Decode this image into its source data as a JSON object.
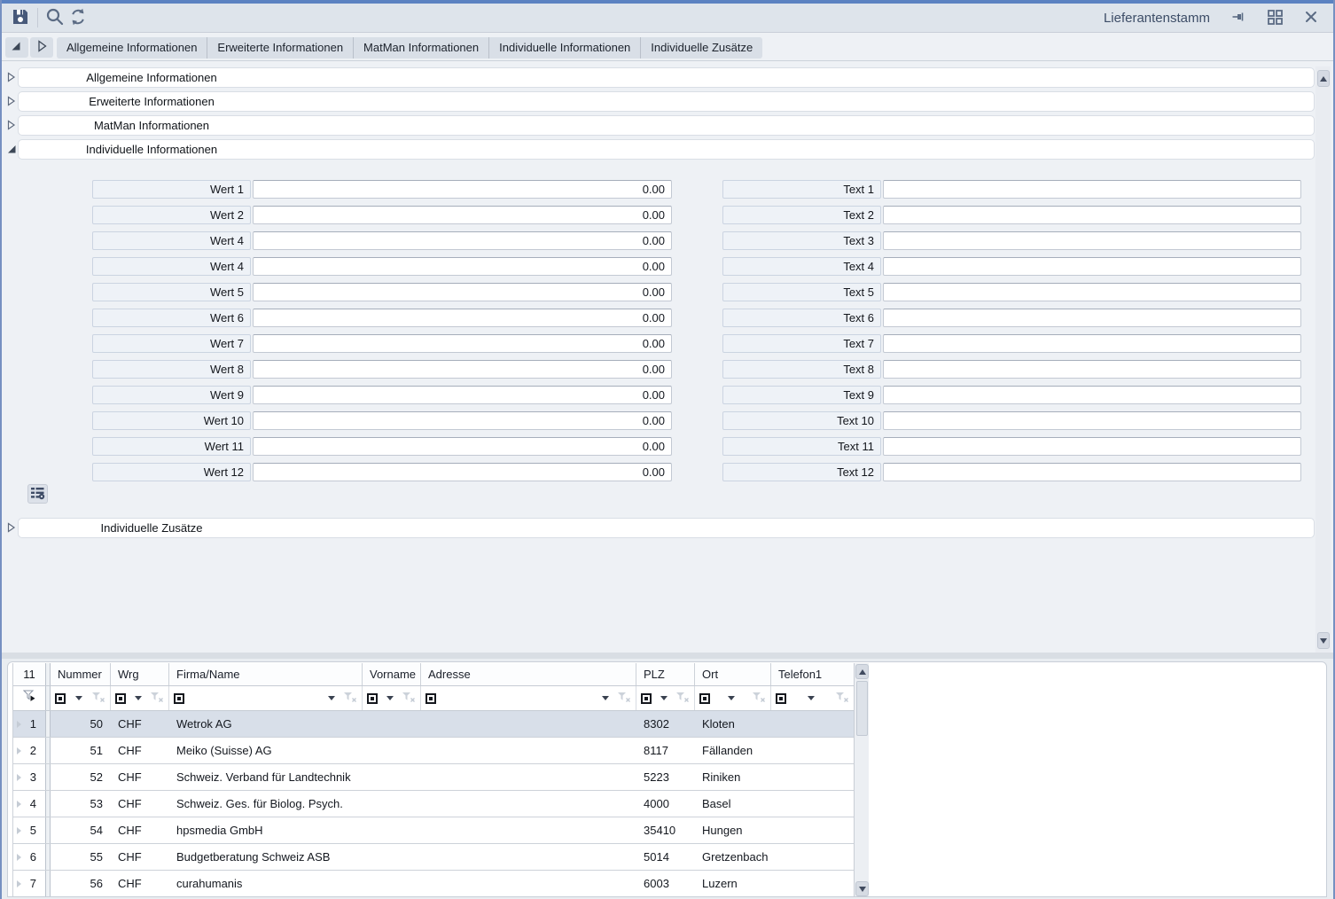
{
  "window": {
    "title": "Lieferantenstamm"
  },
  "toolbar": {
    "left_icons": [
      "save",
      "search",
      "refresh"
    ],
    "right_icons": [
      "pin",
      "layout-grid",
      "close"
    ]
  },
  "tab_bar": {
    "tabs": [
      "Allgemeine Informationen",
      "Erweiterte Informationen",
      "MatMan Informationen",
      "Individuelle Informationen",
      "Individuelle Zusätze"
    ]
  },
  "sections": [
    {
      "label": "Allgemeine Informationen",
      "expanded": false
    },
    {
      "label": "Erweiterte Informationen",
      "expanded": false
    },
    {
      "label": "MatMan Informationen",
      "expanded": false
    },
    {
      "label": "Individuelle Informationen",
      "expanded": true
    },
    {
      "label": "Individuelle Zusätze",
      "expanded": false
    }
  ],
  "form": {
    "value_fields": [
      {
        "label": "Wert 1",
        "value": "0.00"
      },
      {
        "label": "Wert 2",
        "value": "0.00"
      },
      {
        "label": "Wert 4",
        "value": "0.00"
      },
      {
        "label": "Wert 4",
        "value": "0.00"
      },
      {
        "label": "Wert 5",
        "value": "0.00"
      },
      {
        "label": "Wert 6",
        "value": "0.00"
      },
      {
        "label": "Wert 7",
        "value": "0.00"
      },
      {
        "label": "Wert 8",
        "value": "0.00"
      },
      {
        "label": "Wert 9",
        "value": "0.00"
      },
      {
        "label": "Wert 10",
        "value": "0.00"
      },
      {
        "label": "Wert 11",
        "value": "0.00"
      },
      {
        "label": "Wert 12",
        "value": "0.00"
      }
    ],
    "text_fields": [
      {
        "label": "Text 1",
        "value": ""
      },
      {
        "label": "Text 2",
        "value": ""
      },
      {
        "label": "Text 3",
        "value": ""
      },
      {
        "label": "Text 4",
        "value": ""
      },
      {
        "label": "Text 5",
        "value": ""
      },
      {
        "label": "Text 6",
        "value": ""
      },
      {
        "label": "Text 7",
        "value": ""
      },
      {
        "label": "Text 8",
        "value": ""
      },
      {
        "label": "Text 9",
        "value": ""
      },
      {
        "label": "Text 10",
        "value": ""
      },
      {
        "label": "Text 11",
        "value": ""
      },
      {
        "label": "Text 12",
        "value": ""
      }
    ]
  },
  "grid": {
    "row_count_badge": "11",
    "columns": [
      "Nummer",
      "Wrg",
      "Firma/Name",
      "Vorname",
      "Adresse",
      "PLZ",
      "Ort",
      "Telefon1"
    ],
    "rows": [
      {
        "num": "1",
        "selected": true,
        "cells": [
          "50",
          "CHF",
          "Wetrok AG",
          "",
          "",
          "8302",
          "Kloten",
          ""
        ]
      },
      {
        "num": "2",
        "selected": false,
        "cells": [
          "51",
          "CHF",
          "Meiko (Suisse) AG",
          "",
          "",
          "8117",
          "Fällanden",
          ""
        ]
      },
      {
        "num": "3",
        "selected": false,
        "cells": [
          "52",
          "CHF",
          "Schweiz. Verband für Landtechnik",
          "",
          "",
          "5223",
          "Riniken",
          ""
        ]
      },
      {
        "num": "4",
        "selected": false,
        "cells": [
          "53",
          "CHF",
          "Schweiz. Ges. für Biolog. Psych.",
          "",
          "",
          "4000",
          "Basel",
          ""
        ]
      },
      {
        "num": "5",
        "selected": false,
        "cells": [
          "54",
          "CHF",
          "hpsmedia GmbH",
          "",
          "",
          "35410",
          "Hungen",
          ""
        ]
      },
      {
        "num": "6",
        "selected": false,
        "cells": [
          "55",
          "CHF",
          "Budgetberatung Schweiz ASB",
          "",
          "",
          "5014",
          "Gretzenbach",
          ""
        ]
      },
      {
        "num": "7",
        "selected": false,
        "cells": [
          "56",
          "CHF",
          "curahumanis",
          "",
          "",
          "6003",
          "Luzern",
          ""
        ]
      }
    ]
  },
  "colors": {
    "accent_blue": "#5b82c1",
    "selected_row": "#d8dfe9",
    "toolbar_bg": "#dee4eb",
    "icon": "#5b6b84"
  }
}
